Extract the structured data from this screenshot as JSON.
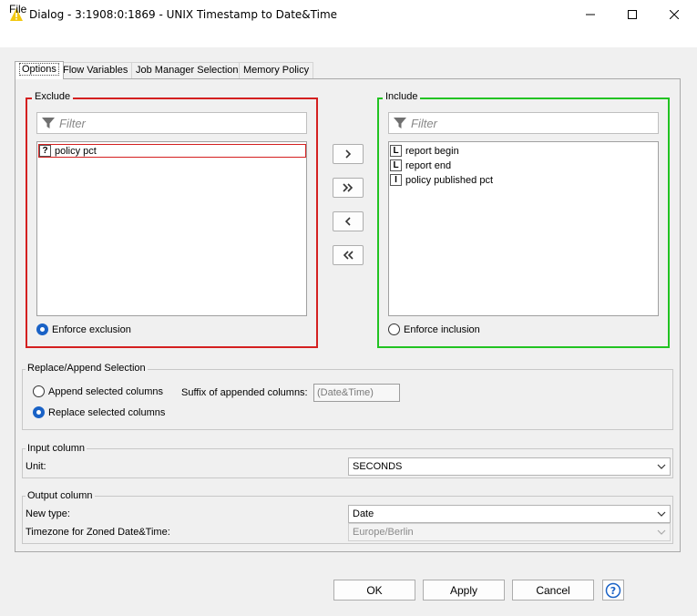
{
  "window": {
    "title": "Dialog - 3:1908:0:1869 - UNIX Timestamp to Date&Time",
    "icon": "warning-triangle-icon",
    "accent_icon_color": "#f2c811"
  },
  "menu": {
    "file_label": "File"
  },
  "tabs": [
    {
      "label": "Options",
      "selected": true
    },
    {
      "label": "Flow Variables",
      "selected": false
    },
    {
      "label": "Job Manager Selection",
      "selected": false
    },
    {
      "label": "Memory Policy",
      "selected": false
    }
  ],
  "exclude": {
    "legend": "Exclude",
    "border_color": "#d42020",
    "filter_placeholder": "Filter",
    "items": [
      {
        "type_icon": "?",
        "label": "policy pct",
        "selected": true
      }
    ],
    "enforce_label": "Enforce exclusion",
    "enforce_selected": true
  },
  "include": {
    "legend": "Include",
    "border_color": "#22c322",
    "filter_placeholder": "Filter",
    "items": [
      {
        "type_icon": "L",
        "label": "report begin"
      },
      {
        "type_icon": "L",
        "label": "report end"
      },
      {
        "type_icon": "I",
        "label": "policy published pct"
      }
    ],
    "enforce_label": "Enforce inclusion",
    "enforce_selected": false
  },
  "move_buttons": {
    "add": ">",
    "add_all": ">>",
    "remove": "<",
    "remove_all": "<<"
  },
  "replace_append": {
    "legend": "Replace/Append Selection",
    "append_label": "Append selected columns",
    "replace_label": "Replace selected columns",
    "selected": "replace",
    "suffix_label": "Suffix of appended columns:",
    "suffix_value": "(Date&Time)"
  },
  "input_column": {
    "legend": "Input column",
    "unit_label": "Unit:",
    "unit_value": "SECONDS"
  },
  "output_column": {
    "legend": "Output column",
    "new_type_label": "New type:",
    "new_type_value": "Date",
    "timezone_label": "Timezone for Zoned Date&Time:",
    "timezone_value": "Europe/Berlin"
  },
  "buttons": {
    "ok": "OK",
    "apply": "Apply",
    "cancel": "Cancel",
    "help": "?"
  }
}
